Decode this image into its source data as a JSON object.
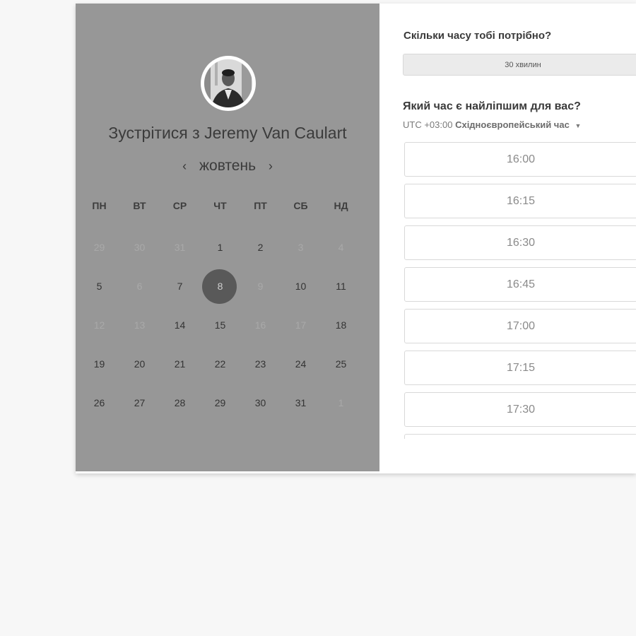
{
  "host": {
    "title": "Зустрітися з Jeremy Van Caulart"
  },
  "calendar": {
    "month": "жовтень",
    "prev_arrow": "‹",
    "next_arrow": "›",
    "weekdays": [
      "ПН",
      "ВТ",
      "СР",
      "ЧТ",
      "ПТ",
      "СБ",
      "НД"
    ],
    "weeks": [
      [
        {
          "d": "29",
          "m": true
        },
        {
          "d": "30",
          "m": true
        },
        {
          "d": "31",
          "m": true
        },
        {
          "d": "1"
        },
        {
          "d": "2"
        },
        {
          "d": "3",
          "m": true
        },
        {
          "d": "4",
          "m": true
        }
      ],
      [
        {
          "d": "5"
        },
        {
          "d": "6",
          "m": true
        },
        {
          "d": "7"
        },
        {
          "d": "8",
          "sel": true
        },
        {
          "d": "9",
          "m": true
        },
        {
          "d": "10"
        },
        {
          "d": "11"
        }
      ],
      [
        {
          "d": "12",
          "m": true
        },
        {
          "d": "13",
          "m": true
        },
        {
          "d": "14"
        },
        {
          "d": "15"
        },
        {
          "d": "16",
          "m": true
        },
        {
          "d": "17",
          "m": true
        },
        {
          "d": "18"
        }
      ],
      [
        {
          "d": "19"
        },
        {
          "d": "20"
        },
        {
          "d": "21"
        },
        {
          "d": "22"
        },
        {
          "d": "23"
        },
        {
          "d": "24"
        },
        {
          "d": "25"
        }
      ],
      [
        {
          "d": "26"
        },
        {
          "d": "27"
        },
        {
          "d": "28"
        },
        {
          "d": "29"
        },
        {
          "d": "30"
        },
        {
          "d": "31"
        },
        {
          "d": "1",
          "m": true
        }
      ]
    ]
  },
  "booking": {
    "duration_question": "Скільки часу тобі потрібно?",
    "duration_value": "30 хвилин",
    "time_question": "Який час є найліпшим для вас?",
    "timezone_offset": "UTC +03:00",
    "timezone_name": "Східноєвропейський час",
    "timezone_caret": "▼",
    "slots": [
      "16:00",
      "16:15",
      "16:30",
      "16:45",
      "17:00",
      "17:15",
      "17:30",
      ""
    ]
  },
  "colors": {
    "left_panel": "#979797",
    "selected_day": "#595959"
  }
}
